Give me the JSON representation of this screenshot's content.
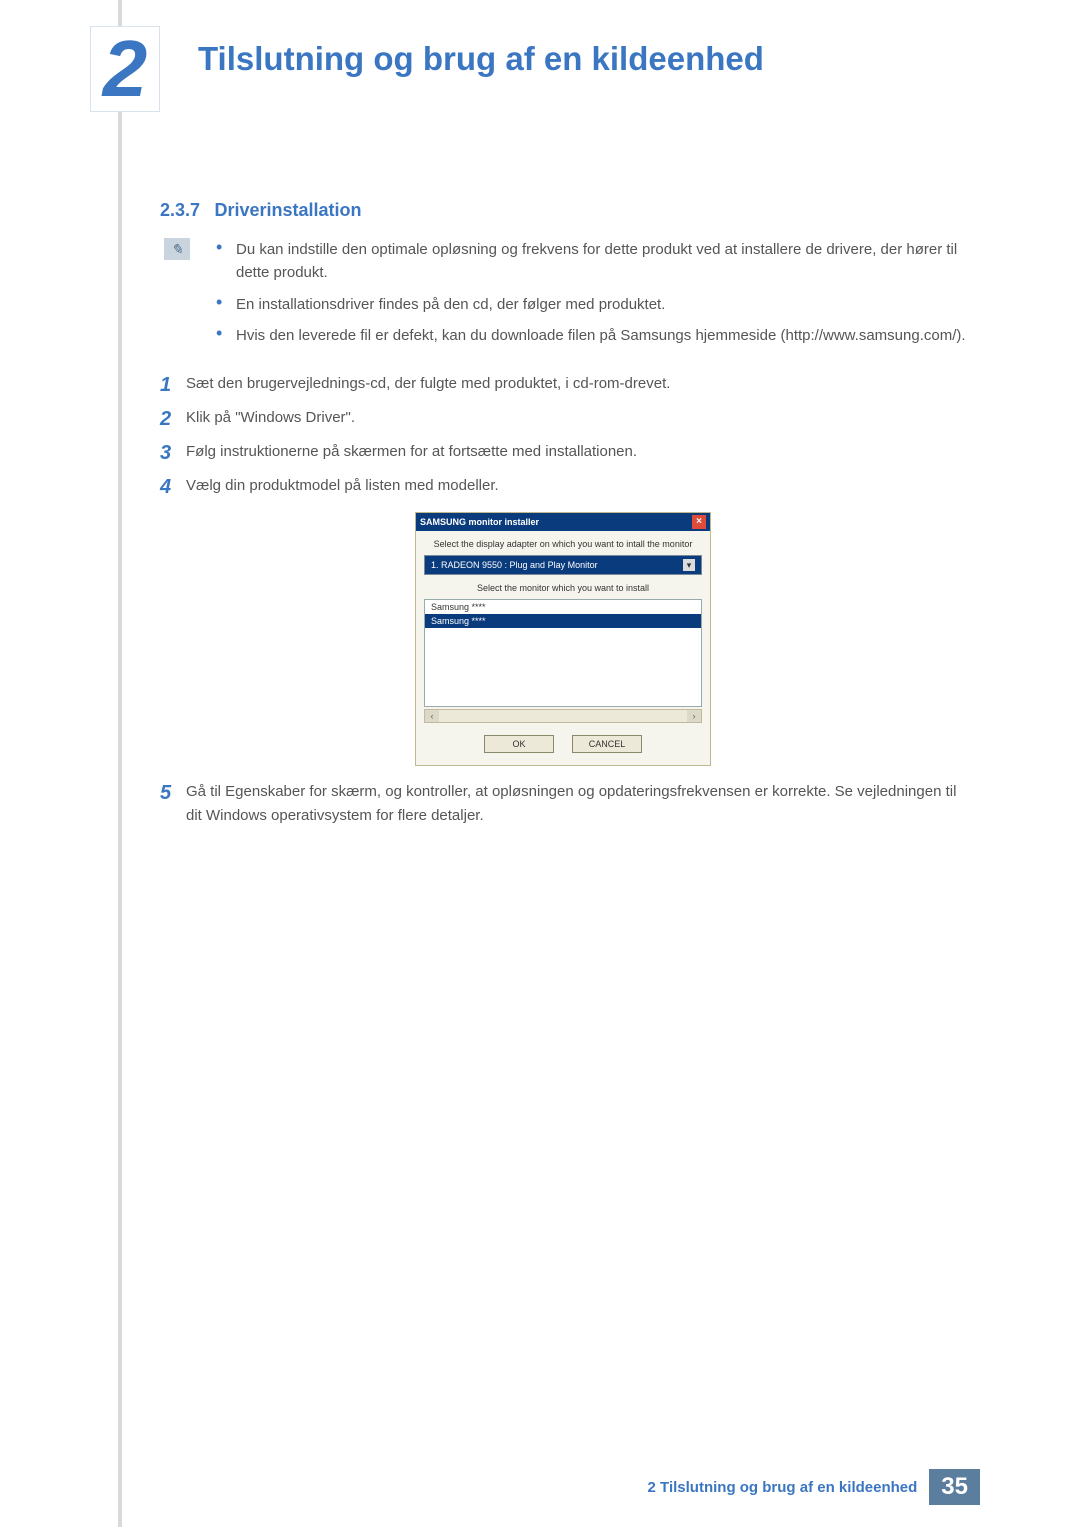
{
  "header": {
    "chapter_number": "2",
    "chapter_title": "Tilslutning og brug af en kildeenhed"
  },
  "section": {
    "number": "2.3.7",
    "title": "Driverinstallation"
  },
  "note": {
    "icon_glyph": "✎",
    "bullets": [
      "Du kan indstille den optimale opløsning og frekvens for dette produkt ved at installere de drivere, der hører til dette produkt.",
      "En installationsdriver findes på den cd, der følger med produktet.",
      "Hvis den leverede fil er defekt, kan du downloade filen på Samsungs hjemmeside (http://www.samsung.com/)."
    ]
  },
  "steps": [
    {
      "n": "1",
      "text": "Sæt den brugervejlednings-cd, der fulgte med produktet, i cd-rom-drevet."
    },
    {
      "n": "2",
      "text": "Klik på \"Windows Driver\"."
    },
    {
      "n": "3",
      "text": "Følg instruktionerne på skærmen for at fortsætte med installationen."
    },
    {
      "n": "4",
      "text": "Vælg din produktmodel på listen med modeller."
    },
    {
      "n": "5",
      "text": "Gå til Egenskaber for skærm, og kontroller, at opløsningen og opdateringsfrekvensen er korrekte. Se vejledningen til dit Windows operativsystem for flere detaljer."
    }
  ],
  "installer_dialog": {
    "title": "SAMSUNG monitor installer",
    "close_glyph": "×",
    "prompt_adapter": "Select the display adapter on which you want to intall the monitor",
    "adapter_value": "1. RADEON 9550 : Plug and Play Monitor",
    "prompt_monitor": "Select the monitor which you want to install",
    "list_rows": [
      "Samsung ****",
      "Samsung ****"
    ],
    "scroll_left": "‹",
    "scroll_right": "›",
    "btn_ok": "OK",
    "btn_cancel": "CANCEL"
  },
  "footer": {
    "text": "2 Tilslutning og brug af en kildeenhed",
    "page": "35"
  }
}
